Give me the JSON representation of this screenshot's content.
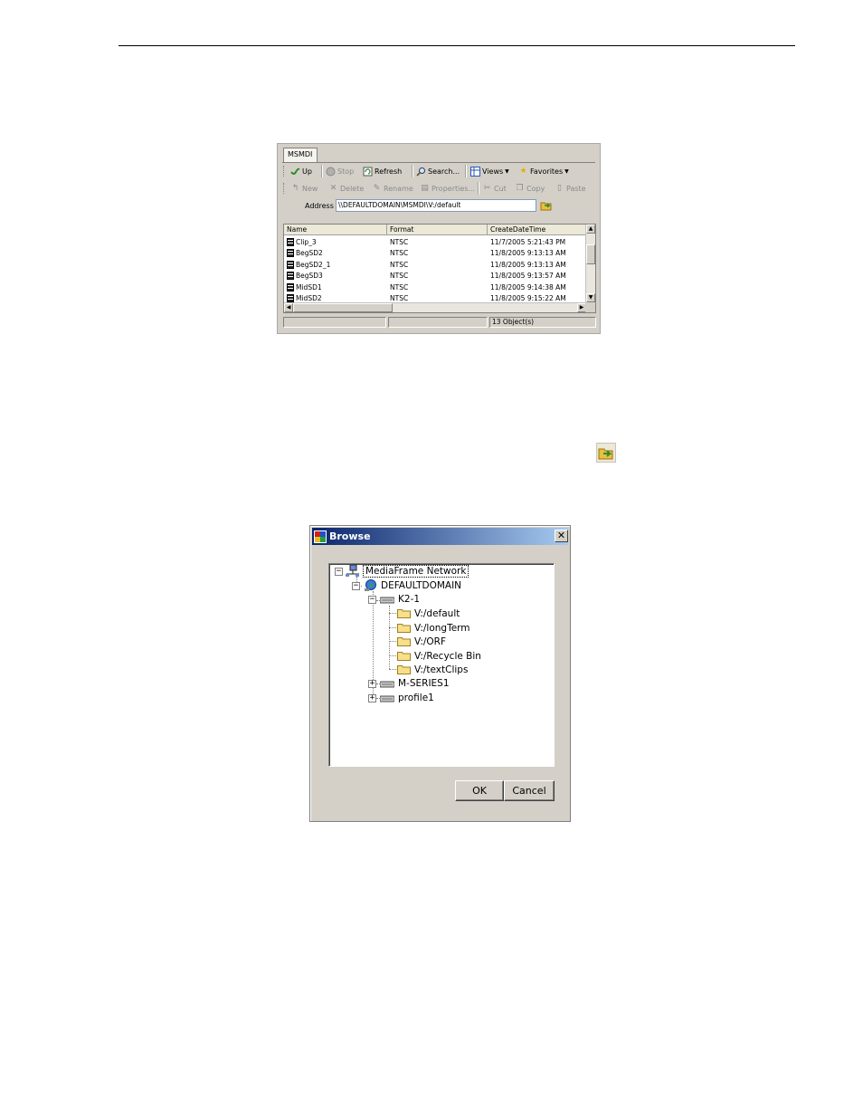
{
  "explorer": {
    "tab_label": "MSMDI",
    "toolbar1": {
      "up": "Up",
      "stop": "Stop",
      "refresh": "Refresh",
      "search": "Search...",
      "views": "Views",
      "favorites": "Favorites"
    },
    "toolbar2": {
      "new": "New",
      "delete": "Delete",
      "rename": "Rename",
      "properties": "Properties...",
      "cut": "Cut",
      "copy": "Copy",
      "paste": "Paste"
    },
    "address_label": "Address",
    "address_value": "\\\\DEFAULTDOMAIN\\MSMDI\\V:/default",
    "columns": [
      "Name",
      "Format",
      "CreateDateTime"
    ],
    "rows": [
      {
        "name": "Clip_3",
        "format": "NTSC",
        "date": "11/7/2005 5:21:43 PM"
      },
      {
        "name": "BegSD2",
        "format": "NTSC",
        "date": "11/8/2005 9:13:13 AM"
      },
      {
        "name": "BegSD2_1",
        "format": "NTSC",
        "date": "11/8/2005 9:13:13 AM"
      },
      {
        "name": "BegSD3",
        "format": "NTSC",
        "date": "11/8/2005 9:13:57 AM"
      },
      {
        "name": "MidSD1",
        "format": "NTSC",
        "date": "11/8/2005 9:14:38 AM"
      },
      {
        "name": "MidSD2",
        "format": "NTSC",
        "date": "11/8/2005 9:15:22 AM"
      }
    ],
    "status": [
      "",
      "",
      "13 Object(s)"
    ]
  },
  "browse_dialog": {
    "title": "Browse",
    "close_glyph": "✕",
    "tree": {
      "root": "MediaFrame Network",
      "domain": "DEFAULTDOMAIN",
      "machine": "K2-1",
      "folders": [
        "V:/default",
        "V:/longTerm",
        "V:/ORF",
        "V:/Recycle Bin",
        "V:/textClips"
      ],
      "others": [
        "M-SERIES1",
        "profile1"
      ]
    },
    "ok_label": "OK",
    "cancel_label": "Cancel"
  }
}
